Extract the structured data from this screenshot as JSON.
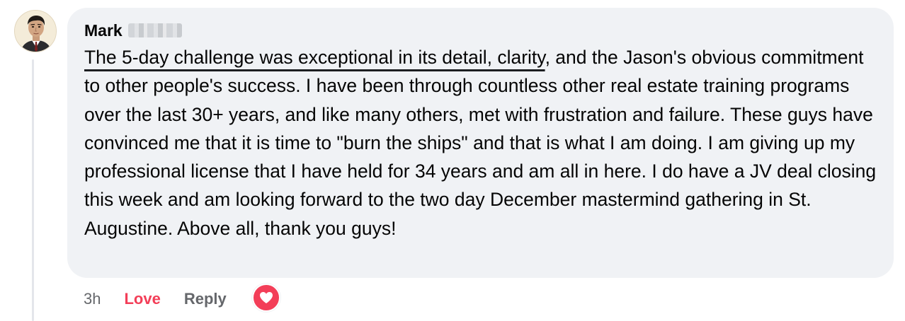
{
  "comment": {
    "author": "Mark",
    "text_highlighted": "The 5-day challenge was exceptional in its detail, clarity",
    "text_rest": ", and the Jason's obvious commitment to other people's success. I have been through countless other real estate training programs over the last 30+ years, and like many others, met with frustration and failure. These guys have convinced me that it is time to \"burn the ships\" and that is what I am doing. I am giving up my professional license that I have held for 34 years and am all in here. I do have a JV deal closing this week and am looking forward to the two day December mastermind gathering in St. Augustine. Above all, thank you guys!",
    "timestamp": "3h",
    "love_label": "Love",
    "reply_label": "Reply",
    "reaction_icon": "heart-icon"
  },
  "colors": {
    "bubble_bg": "#f0f2f5",
    "love_red": "#f33e58",
    "secondary_text": "#65676b"
  }
}
